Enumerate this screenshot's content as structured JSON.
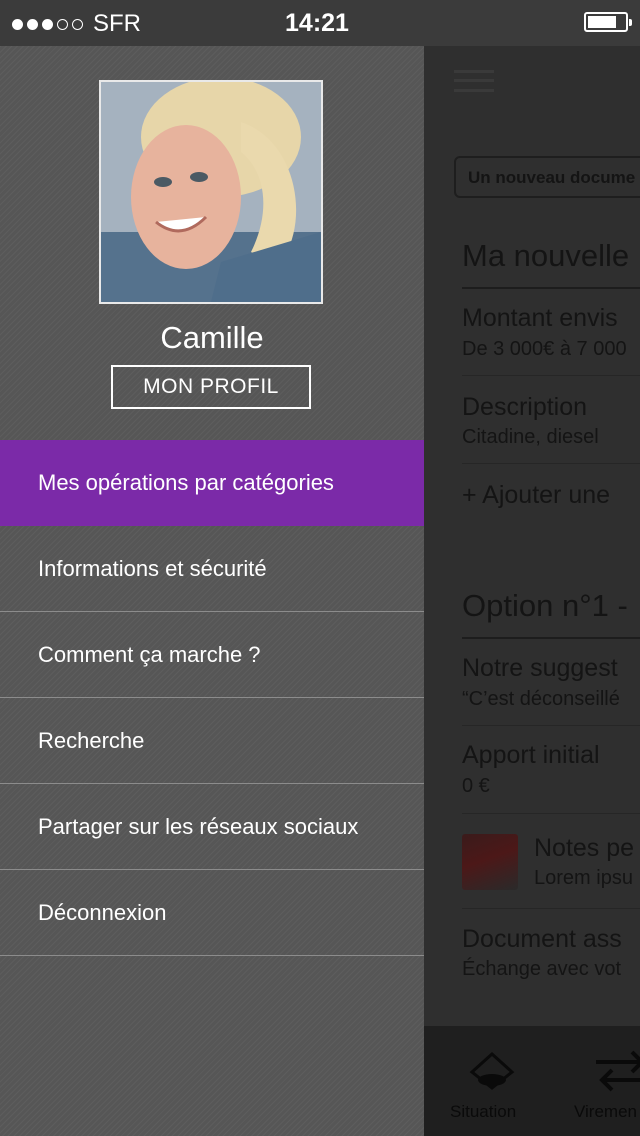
{
  "status_bar": {
    "signal_dots": [
      true,
      true,
      true,
      false,
      false
    ],
    "carrier": "SFR",
    "time": "14:21",
    "battery_icon": "battery-icon"
  },
  "drawer": {
    "user_name": "Camille",
    "profile_button": "MON PROFIL",
    "avatar_alt": "avatar",
    "menu": [
      {
        "label": "Mes opérations par catégories",
        "active": true
      },
      {
        "label": "Informations et sécurité",
        "active": false
      },
      {
        "label": "Comment ça marche ?",
        "active": false
      },
      {
        "label": "Recherche",
        "active": false
      },
      {
        "label": "Partager sur les réseaux sociaux",
        "active": false
      },
      {
        "label": "Déconnexion",
        "active": false
      }
    ],
    "accent_color": "#7b2aa8"
  },
  "background_screen": {
    "new_document_button": "Un nouveau docume",
    "section_title": "Ma nouvelle",
    "fields": [
      {
        "label": "Montant envis",
        "value": "De 3 000€ à 7 000"
      },
      {
        "label": "Description",
        "value": "Citadine, diesel"
      }
    ],
    "add_link": "+ Ajouter une",
    "option_title": "Option n°1 - ",
    "option_fields": [
      {
        "label": "Notre suggest",
        "value": "“C’est déconseillé"
      },
      {
        "label": "Apport initial",
        "value": "0 €"
      }
    ],
    "notes": {
      "label": "Notes pe",
      "value": "Lorem ipsu"
    },
    "document": {
      "label": "Document ass",
      "value": "Échange avec vot"
    },
    "tabs": [
      {
        "label": "Situation",
        "icon": "piggy-bank-icon"
      },
      {
        "label": "Viremen",
        "icon": "transfer-arrows-icon"
      }
    ]
  }
}
